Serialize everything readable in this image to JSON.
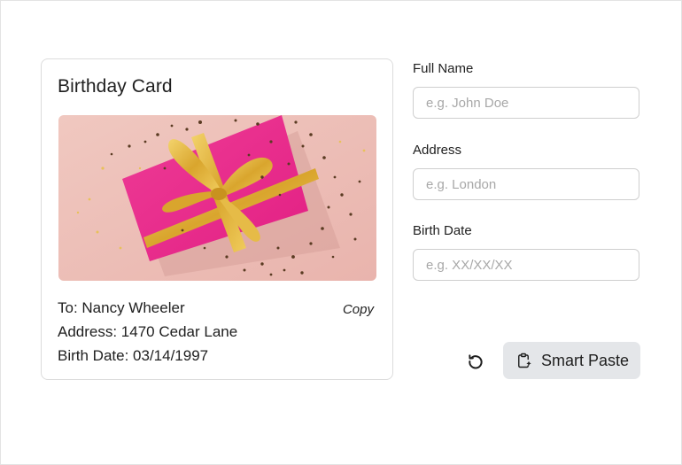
{
  "card": {
    "title": "Birthday Card",
    "image_alt": "gift box",
    "to_line": "To: Nancy Wheeler",
    "address_line": "Address: 1470 Cedar Lane",
    "birth_date_line": "Birth Date: 03/14/1997",
    "copy_label": "Copy"
  },
  "form": {
    "full_name": {
      "label": "Full Name",
      "placeholder": "e.g. John Doe",
      "value": ""
    },
    "address": {
      "label": "Address",
      "placeholder": "e.g. London",
      "value": ""
    },
    "birth_date": {
      "label": "Birth Date",
      "placeholder": "e.g. XX/XX/XX",
      "value": ""
    }
  },
  "actions": {
    "reset_icon": "reset-icon",
    "smart_paste_icon": "clipboard-paste-icon",
    "smart_paste_label": "Smart Paste"
  },
  "colors": {
    "button_bg": "#e4e6e9",
    "gift_pink": "#e8288a",
    "ribbon_gold": "#e0b43a",
    "background_pink": "#f2c4bd"
  }
}
